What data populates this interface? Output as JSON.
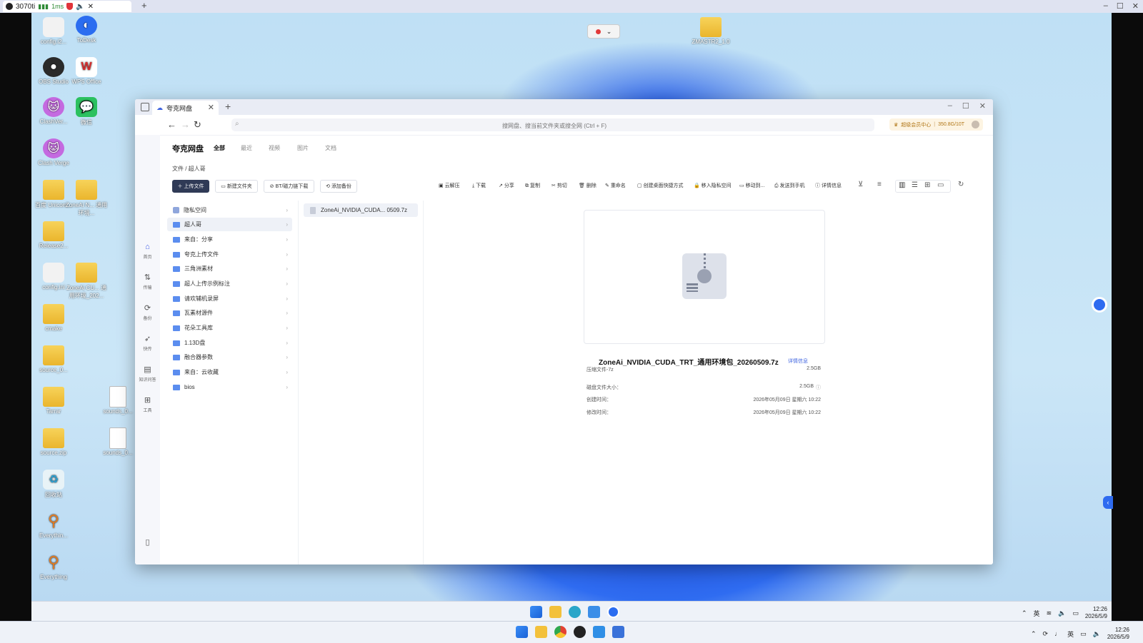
{
  "remote": {
    "tab_title": "3070ti",
    "latency": "1ms"
  },
  "desktop": {
    "icons": [
      {
        "label": "config.i2...",
        "kind": "file"
      },
      {
        "label": "ToDesk",
        "kind": "app"
      },
      {
        "label": "OBS Studio",
        "kind": "app"
      },
      {
        "label": "WPS Office",
        "kind": "app"
      },
      {
        "label": "ClashVer...",
        "kind": "app"
      },
      {
        "label": "微信",
        "kind": "app"
      },
      {
        "label": "Clash Verge",
        "kind": "app"
      },
      {
        "label": "百度 Unicom...",
        "kind": "folder"
      },
      {
        "label": "ZoneAi N... 通用环境...",
        "kind": "folder"
      },
      {
        "label": "Release2...",
        "kind": "folder"
      },
      {
        "label": "config.ini",
        "kind": "file"
      },
      {
        "label": "ZoneAi CU... 通用环境_202...",
        "kind": "folder"
      },
      {
        "label": "cmake",
        "kind": "folder"
      },
      {
        "label": "source_0...",
        "kind": "folder"
      },
      {
        "label": "Tarrar",
        "kind": "folder"
      },
      {
        "label": "sounds_0...",
        "kind": "file"
      },
      {
        "label": "source.zip",
        "kind": "folder"
      },
      {
        "label": "sounds_0...",
        "kind": "file"
      },
      {
        "label": "回收站",
        "kind": "app"
      },
      {
        "label": "Everythin...",
        "kind": "app"
      },
      {
        "label": "Everything",
        "kind": "app"
      },
      {
        "label": "ZMASTR2_1.0",
        "kind": "folder"
      }
    ]
  },
  "app": {
    "tab_title": "夸克网盘",
    "search_placeholder": "搜网盘、搜当前文件夹或搜全网 (Ctrl + F)",
    "vip_label": "超级会员中心",
    "vip_quota": "350.8G/10T",
    "brand": "夸克网盘",
    "category_tabs": [
      "全部",
      "最近",
      "视频",
      "图片",
      "文档"
    ],
    "breadcrumb": "文件 / 超人哥",
    "rail": [
      {
        "label": "首页",
        "icon": "home-icon"
      },
      {
        "label": "传输",
        "icon": "transfer-icon"
      },
      {
        "label": "备份",
        "icon": "sync-icon"
      },
      {
        "label": "快传",
        "icon": "send-icon"
      },
      {
        "label": "知识问答",
        "icon": "qa-icon"
      },
      {
        "label": "工具",
        "icon": "toolbox-icon"
      }
    ],
    "toolbar": {
      "upload": "上传文件",
      "new_folder": "新建文件夹",
      "bt_download": "BT/磁力链下载",
      "add_backup": "添加备份",
      "actions": [
        "云解压",
        "下载",
        "分享",
        "复制",
        "剪切",
        "删除",
        "重命名",
        "创建桌面快捷方式",
        "移入隐私空间",
        "移动到...",
        "发送到手机",
        "详情信息"
      ]
    },
    "folders": [
      "隐私空间",
      "超人哥",
      "来自：分享",
      "夸克上传文件",
      "三角洲素材",
      "超人上传示例标注",
      "请欢辅机录屏",
      "瓦素材源件",
      "花朵工具库",
      "1.13D盘",
      "融合器参数",
      "来自：云收藏",
      "bios"
    ],
    "selected_folder": "超人哥",
    "files": [
      "ZoneAi_NVIDIA_CUDA... 0509.7z"
    ],
    "preview": {
      "filename": "ZoneAi_NVIDIA_CUDA_TRT_通用环境包_20260509.7z",
      "detail_link": "详情信息",
      "type_label": "压缩文件-7z",
      "type_size": "2.5GB",
      "disk_size_label": "磁盘文件大小：",
      "disk_size": "2.5GB",
      "created_label": "创建时间：",
      "created": "2026年05月09日 星期六 10:22",
      "modified_label": "修改时间：",
      "modified": "2026年05月09日 星期六 10:22"
    }
  },
  "taskbar_inner": {
    "ime": "英",
    "time": "12:26",
    "date": "2026/5/9"
  },
  "taskbar_outer": {
    "ime": "英",
    "time": "12:26",
    "date": "2026/5/9"
  }
}
